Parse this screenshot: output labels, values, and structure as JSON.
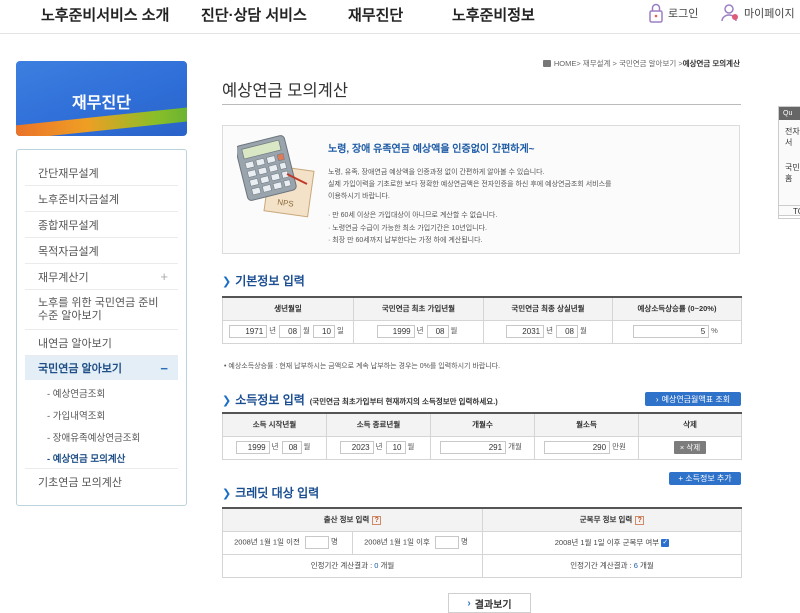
{
  "topnav": {
    "items": [
      "노후준비서비스 소개",
      "진단·상담 서비스",
      "재무진단",
      "노후준비정보"
    ],
    "login": "로그인",
    "mypage": "마이페이지"
  },
  "sidebar": {
    "banner_title": "재무진단",
    "items": [
      {
        "label": "간단재무설계"
      },
      {
        "label": "노후준비자금설계"
      },
      {
        "label": "종합재무설계"
      },
      {
        "label": "목적자금설계"
      },
      {
        "label": "재무계산기",
        "toggle": "+"
      },
      {
        "label": "노후를 위한 국민연금 준비수준 알아보기"
      },
      {
        "label": "내연금 알아보기"
      },
      {
        "label": "국민연금 알아보기",
        "toggle": "−"
      },
      {
        "label": "기초연금 모의계산"
      }
    ],
    "subitems": [
      "- 예상연금조회",
      "- 가입내역조회",
      "- 장애유족예상연금조회",
      "- 예상연금 모의계산"
    ]
  },
  "breadcrumb": {
    "home": "HOME",
    "path": " > 재무설계 > 국민연금 알아보기 > ",
    "current": "예상연금 모의계산"
  },
  "page_title": "예상연금 모의계산",
  "intro": {
    "icon_label": "NPS",
    "headline": "노령, 장애 유족연금 예상액을 인증없이 간편하게~",
    "para1": "노령, 유족, 장애연금 예상액을 인증과정 없이 간편하게 알아볼 수 있습니다.",
    "para2": "실제 가입이력을 기초로한 보다 정확한 예상연금액은 전자인증을 하신 후에 예상연금조회 서비스를",
    "para3": "이용하시기 바랍니다.",
    "bullets": [
      "· 만 60세 이상은 가입대상이 아니므로 계산할 수 없습니다.",
      "· 노령연금 수급이 가능한 최소 가입기간은 10년입니다.",
      "· 최장 만 60세까지 납부한다는 가정 하에 계산됩니다."
    ]
  },
  "basic": {
    "heading": "기본정보 입력",
    "headers": [
      "생년월일",
      "국민연금 최초 가입년월",
      "국민연금 최종 상실년월",
      "예상소득상승률 (0~20%)"
    ],
    "birth": {
      "year": "1971",
      "month": "08",
      "day": "10"
    },
    "first_join": {
      "year": "1999",
      "month": "08"
    },
    "last_loss": {
      "year": "2031",
      "month": "08"
    },
    "rate": "5",
    "units": {
      "year": "년",
      "month": "월",
      "day": "일",
      "percent": "%"
    },
    "footnote": "• 예상소득상승률 : 현재 납부하시는 금액으로 계속 납부하는 경우는 0%를 입력하시기 바랍니다."
  },
  "income": {
    "heading": "소득정보 입력",
    "note": "(국민연금 최초가입부터 현재까지의 소득정보만 입력하세요.)",
    "lookup_button": "예상연금월액표 조회",
    "headers": [
      "소득 시작년월",
      "소득 종료년월",
      "개월수",
      "월소득",
      "삭제"
    ],
    "row": {
      "start_year": "1999",
      "start_month": "08",
      "end_year": "2023",
      "end_month": "10",
      "months": "291",
      "income": "290"
    },
    "units": {
      "year": "년",
      "month": "월",
      "months": "개월",
      "won": "만원"
    },
    "delete_button": "× 삭제",
    "add_button": "+ 소득정보 추가"
  },
  "credit": {
    "heading": "크레딧 대상 입력",
    "birth_header": "출산 정보 입력",
    "military_header": "군복무 정보 입력",
    "help_mark": "?",
    "before_label": "2008년 1월 1일 이전",
    "after_label": "2008년 1월 1일 이후",
    "person_unit": "명",
    "military_label": "2008년 1월 1일 이후 군복무 여부",
    "birth_result_label": "인정기간 계산결과 : ",
    "birth_result_value": "0",
    "military_result_label": "인정기간 계산결과 : ",
    "military_result_value": "6",
    "result_unit": " 개월"
  },
  "result_button": "결과보기",
  "quick": {
    "header": "Qu",
    "line1": "전자",
    "line2": "서",
    "line3": "국민",
    "line4": "홈",
    "bottom": "TO"
  }
}
